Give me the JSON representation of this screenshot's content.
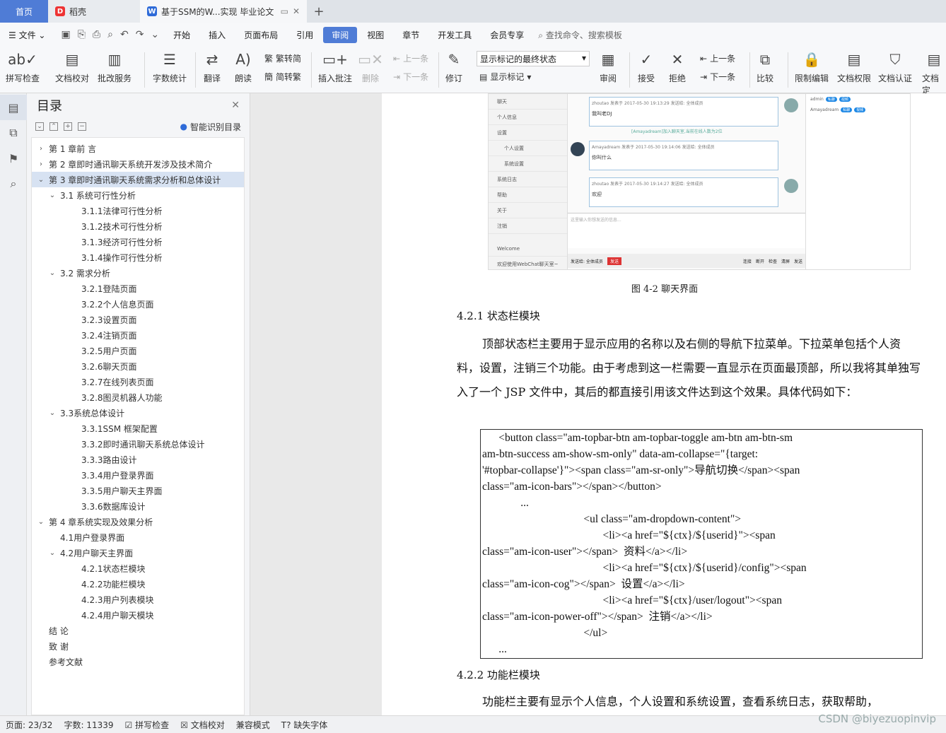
{
  "tabs": {
    "home": "首页",
    "daoke": "稻壳",
    "doc": "基于SSM的W...实现 毕业论文"
  },
  "menu": {
    "file": "文件",
    "items": [
      "开始",
      "插入",
      "页面布局",
      "引用",
      "审阅",
      "视图",
      "章节",
      "开发工具",
      "会员专享"
    ],
    "active": "审阅",
    "search": "查找命令、搜索模板"
  },
  "ribbon": {
    "spellcheck": "拼写检查",
    "doccheck": "文档校对",
    "batch": "批改服务",
    "wordcount": "字数统计",
    "translate": "翻译",
    "read": "朗读",
    "trad": "繁转简",
    "simp": "简转繁",
    "insert_comment": "插入批注",
    "delete": "删除",
    "prev": "上一条",
    "next": "下一条",
    "revise": "修订",
    "show_mode": "显示标记的最终状态",
    "show_marks": "显示标记",
    "review": "审阅",
    "accept": "接受",
    "reject": "拒绝",
    "prev2": "上一条",
    "next2": "下一条",
    "compare": "比较",
    "restrict": "限制编辑",
    "perm": "文档权限",
    "auth": "文档认证",
    "cut": "文档定"
  },
  "toc": {
    "title": "目录",
    "smart": "智能识别目录",
    "items": [
      {
        "text": "第 1 章前 言",
        "level": 1,
        "caret": ">"
      },
      {
        "text": "第 2 章即时通讯聊天系统开发涉及技术简介",
        "level": 1,
        "caret": ">"
      },
      {
        "text": "第 3 章即时通讯聊天系统需求分析和总体设计",
        "level": 1,
        "caret": "v",
        "selected": true
      },
      {
        "text": "3.1  系统可行性分析",
        "level": 2,
        "caret": "v"
      },
      {
        "text": "3.1.1法律可行性分析",
        "level": 3
      },
      {
        "text": "3.1.2技术可行性分析",
        "level": 3
      },
      {
        "text": "3.1.3经济可行性分析",
        "level": 3
      },
      {
        "text": "3.1.4操作可行性分析",
        "level": 3
      },
      {
        "text": "3.2  需求分析",
        "level": 2,
        "caret": "v"
      },
      {
        "text": "3.2.1登陆页面",
        "level": 3
      },
      {
        "text": "3.2.2个人信息页面",
        "level": 3
      },
      {
        "text": "3.2.3设置页面",
        "level": 3
      },
      {
        "text": "3.2.4注销页面",
        "level": 3
      },
      {
        "text": "3.2.5用户页面",
        "level": 3
      },
      {
        "text": "3.2.6聊天页面",
        "level": 3
      },
      {
        "text": "3.2.7在线列表页面",
        "level": 3
      },
      {
        "text": "3.2.8图灵机器人功能",
        "level": 3
      },
      {
        "text": "3.3系统总体设计",
        "level": 2,
        "caret": "v"
      },
      {
        "text": "3.3.1SSM 框架配置",
        "level": 3
      },
      {
        "text": "3.3.2即时通讯聊天系统总体设计",
        "level": 3
      },
      {
        "text": "3.3.3路由设计",
        "level": 3
      },
      {
        "text": "3.3.4用户登录界面",
        "level": 3
      },
      {
        "text": "3.3.5用户聊天主界面",
        "level": 3
      },
      {
        "text": "3.3.6数据库设计",
        "level": 3
      },
      {
        "text": "第 4 章系统实现及效果分析",
        "level": 1,
        "caret": "v"
      },
      {
        "text": "4.1用户登录界面",
        "level": 2
      },
      {
        "text": "4.2用户聊天主界面",
        "level": 2,
        "caret": "v"
      },
      {
        "text": "4.2.1状态栏模块",
        "level": 3
      },
      {
        "text": "4.2.2功能栏模块",
        "level": 3
      },
      {
        "text": "4.2.3用户列表模块",
        "level": 3
      },
      {
        "text": "4.2.4用户聊天模块",
        "level": 3
      },
      {
        "text": "结   论",
        "level": 1
      },
      {
        "text": "致   谢",
        "level": 1
      },
      {
        "text": "参考文献",
        "level": 1
      }
    ]
  },
  "screenshot": {
    "nav": [
      "聊天",
      "个人信息",
      "设置",
      "个人设置",
      "系统设置",
      "系统日志",
      "帮助",
      "关于",
      "注销",
      "Welcome",
      "欢迎使用WebChat聊天室~"
    ],
    "msg1_head": "zhoutao 发表于 2017-05-30 19:13:29 发送给: 全体成员",
    "msg1_text": "我叫老DJ",
    "sys": "[Amayadream]加入聊天室,当前在线人数为2位",
    "msg2_head": "Amayadream 发表于 2017-05-30 19:14:06 发送给: 全体成员",
    "msg2_text": "你叫什么",
    "msg3_head": "zhoutao 发表于 2017-05-30 19:14:27 发送给: 全体成员",
    "msg3_text": "欢迎",
    "input": "这里输入你想发送的信息...",
    "send_to": "发送给: 全体成员",
    "send_btn": "发送",
    "bar_items": [
      "连接",
      "断开",
      "检查",
      "清屏",
      "发送"
    ],
    "user1": "admin",
    "user2": "Amayadream",
    "pill1": "私聊",
    "pill2": "视频"
  },
  "doc": {
    "caption": "图 4-2 聊天界面",
    "h1": "4.2.1  状态栏模块",
    "p1": "顶部状态栏主要用于显示应用的名称以及右侧的导航下拉菜单。下拉菜单包括个人资料，设置，注销三个功能。由于考虑到这一栏需要一直显示在页面最顶部，所以我将其单独写入了一个 JSP 文件中，其后的都直接引用该文件达到这个效果。具体代码如下：",
    "code": [
      "      <button class=\"am-topbar-btn am-topbar-toggle am-btn am-btn-sm",
      "am-btn-success am-show-sm-only\" data-am-collapse=\"{target:",
      "'#topbar-collapse'}\"><span class=\"am-sr-only\">导航切换</span><span",
      "class=\"am-icon-bars\"></span></button>",
      "              ...",
      "                                     <ul class=\"am-dropdown-content\">",
      "                                            <li><a href=\"${ctx}/${userid}\"><span",
      "class=\"am-icon-user\"></span>  资料</a></li>",
      "                                            <li><a href=\"${ctx}/${userid}/config\"><span",
      "class=\"am-icon-cog\"></span>  设置</a></li>",
      "                                            <li><a href=\"${ctx}/user/logout\"><span",
      "class=\"am-icon-power-off\"></span>  注销</a></li>",
      "                                     </ul>",
      "      ..."
    ],
    "h2": "4.2.2  功能栏模块",
    "p2": "功能栏主要有显示个人信息，个人设置和系统设置，查看系统日志，获取帮助，"
  },
  "status": {
    "page": "页面: 23/32",
    "words": "字数: 11339",
    "spell": "拼写检查",
    "proof": "文档校对",
    "compat": "兼容模式",
    "font": "缺失字体"
  },
  "watermark": "CSDN @biyezuopinvip",
  "colors": {
    "accent": "#4f7cd6",
    "selected": "#d7e2f2"
  }
}
